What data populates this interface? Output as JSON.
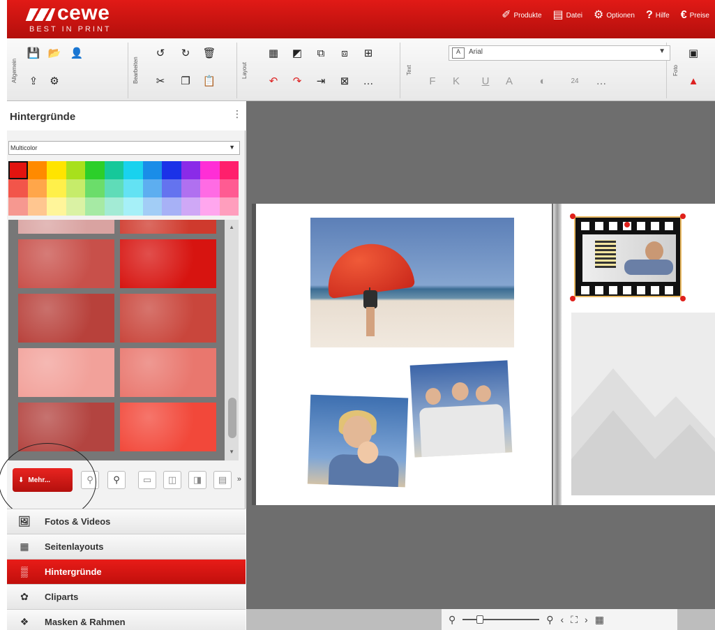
{
  "app": {
    "brand": "cewe",
    "tagline": "BEST IN PRINT"
  },
  "top_menu": [
    {
      "label": "Produkte",
      "icon": "products-icon"
    },
    {
      "label": "Datei",
      "icon": "file-icon"
    },
    {
      "label": "Optionen",
      "icon": "options-icon"
    },
    {
      "label": "Hilfe",
      "icon": "help-icon"
    },
    {
      "label": "Preise",
      "icon": "prices-icon"
    }
  ],
  "toolbar": {
    "groups": [
      "Allgemein",
      "Bearbeiten",
      "Layout",
      "Text",
      "Foto"
    ],
    "font": "Arial",
    "font_size": "24",
    "format_buttons": [
      "F",
      "K",
      "U"
    ]
  },
  "sidebar": {
    "title": "Hintergründe",
    "color_filter": "Multicolor",
    "palette": [
      "#e3140f",
      "#ff8a00",
      "#ffe400",
      "#a8e01c",
      "#2ccf2a",
      "#16c89a",
      "#19d2ee",
      "#1a8de8",
      "#1b32e8",
      "#8a2be8",
      "#ff2ed6",
      "#ff1f6c",
      "#f2554a",
      "#ffa64a",
      "#fff04a",
      "#c6ec6a",
      "#6bdd6a",
      "#5fdcb8",
      "#63e2f3",
      "#5daef0",
      "#6473ef",
      "#b070f0",
      "#ff6be4",
      "#ff5b92",
      "#f69890",
      "#ffc690",
      "#fff59a",
      "#daf2a4",
      "#a6eaa4",
      "#a3ebd5",
      "#a6f0f8",
      "#a2cdf6",
      "#a7b1f6",
      "#cfa8f6",
      "#ffa6ee",
      "#ff9ebd"
    ],
    "tiles": [
      "#d9a3a1",
      "#cf3a2d",
      "#c8504a",
      "#d71410",
      "#b8413b",
      "#c9463c",
      "#f2a19a",
      "#e9776e",
      "#b34440",
      "#f2483a"
    ],
    "more_label": "Mehr..."
  },
  "categories": [
    {
      "label": "Fotos & Videos",
      "icon": "photos-videos-icon",
      "active": false
    },
    {
      "label": "Seitenlayouts",
      "icon": "page-layouts-icon",
      "active": false
    },
    {
      "label": "Hintergründe",
      "icon": "backgrounds-icon",
      "active": true
    },
    {
      "label": "Cliparts",
      "icon": "cliparts-icon",
      "active": false
    },
    {
      "label": "Masken & Rahmen",
      "icon": "masks-frames-icon",
      "active": false
    }
  ]
}
